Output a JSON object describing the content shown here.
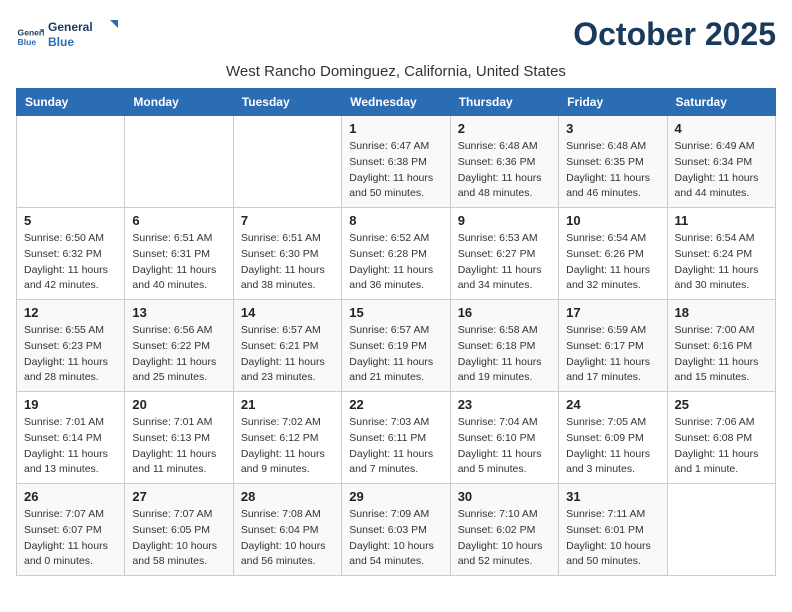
{
  "logo": {
    "general": "General",
    "blue": "Blue"
  },
  "title": "October 2025",
  "subtitle": "West Rancho Dominguez, California, United States",
  "days_of_week": [
    "Sunday",
    "Monday",
    "Tuesday",
    "Wednesday",
    "Thursday",
    "Friday",
    "Saturday"
  ],
  "weeks": [
    [
      {
        "day": "",
        "sunrise": "",
        "sunset": "",
        "daylight": ""
      },
      {
        "day": "",
        "sunrise": "",
        "sunset": "",
        "daylight": ""
      },
      {
        "day": "",
        "sunrise": "",
        "sunset": "",
        "daylight": ""
      },
      {
        "day": "1",
        "sunrise": "Sunrise: 6:47 AM",
        "sunset": "Sunset: 6:38 PM",
        "daylight": "Daylight: 11 hours and 50 minutes."
      },
      {
        "day": "2",
        "sunrise": "Sunrise: 6:48 AM",
        "sunset": "Sunset: 6:36 PM",
        "daylight": "Daylight: 11 hours and 48 minutes."
      },
      {
        "day": "3",
        "sunrise": "Sunrise: 6:48 AM",
        "sunset": "Sunset: 6:35 PM",
        "daylight": "Daylight: 11 hours and 46 minutes."
      },
      {
        "day": "4",
        "sunrise": "Sunrise: 6:49 AM",
        "sunset": "Sunset: 6:34 PM",
        "daylight": "Daylight: 11 hours and 44 minutes."
      }
    ],
    [
      {
        "day": "5",
        "sunrise": "Sunrise: 6:50 AM",
        "sunset": "Sunset: 6:32 PM",
        "daylight": "Daylight: 11 hours and 42 minutes."
      },
      {
        "day": "6",
        "sunrise": "Sunrise: 6:51 AM",
        "sunset": "Sunset: 6:31 PM",
        "daylight": "Daylight: 11 hours and 40 minutes."
      },
      {
        "day": "7",
        "sunrise": "Sunrise: 6:51 AM",
        "sunset": "Sunset: 6:30 PM",
        "daylight": "Daylight: 11 hours and 38 minutes."
      },
      {
        "day": "8",
        "sunrise": "Sunrise: 6:52 AM",
        "sunset": "Sunset: 6:28 PM",
        "daylight": "Daylight: 11 hours and 36 minutes."
      },
      {
        "day": "9",
        "sunrise": "Sunrise: 6:53 AM",
        "sunset": "Sunset: 6:27 PM",
        "daylight": "Daylight: 11 hours and 34 minutes."
      },
      {
        "day": "10",
        "sunrise": "Sunrise: 6:54 AM",
        "sunset": "Sunset: 6:26 PM",
        "daylight": "Daylight: 11 hours and 32 minutes."
      },
      {
        "day": "11",
        "sunrise": "Sunrise: 6:54 AM",
        "sunset": "Sunset: 6:24 PM",
        "daylight": "Daylight: 11 hours and 30 minutes."
      }
    ],
    [
      {
        "day": "12",
        "sunrise": "Sunrise: 6:55 AM",
        "sunset": "Sunset: 6:23 PM",
        "daylight": "Daylight: 11 hours and 28 minutes."
      },
      {
        "day": "13",
        "sunrise": "Sunrise: 6:56 AM",
        "sunset": "Sunset: 6:22 PM",
        "daylight": "Daylight: 11 hours and 25 minutes."
      },
      {
        "day": "14",
        "sunrise": "Sunrise: 6:57 AM",
        "sunset": "Sunset: 6:21 PM",
        "daylight": "Daylight: 11 hours and 23 minutes."
      },
      {
        "day": "15",
        "sunrise": "Sunrise: 6:57 AM",
        "sunset": "Sunset: 6:19 PM",
        "daylight": "Daylight: 11 hours and 21 minutes."
      },
      {
        "day": "16",
        "sunrise": "Sunrise: 6:58 AM",
        "sunset": "Sunset: 6:18 PM",
        "daylight": "Daylight: 11 hours and 19 minutes."
      },
      {
        "day": "17",
        "sunrise": "Sunrise: 6:59 AM",
        "sunset": "Sunset: 6:17 PM",
        "daylight": "Daylight: 11 hours and 17 minutes."
      },
      {
        "day": "18",
        "sunrise": "Sunrise: 7:00 AM",
        "sunset": "Sunset: 6:16 PM",
        "daylight": "Daylight: 11 hours and 15 minutes."
      }
    ],
    [
      {
        "day": "19",
        "sunrise": "Sunrise: 7:01 AM",
        "sunset": "Sunset: 6:14 PM",
        "daylight": "Daylight: 11 hours and 13 minutes."
      },
      {
        "day": "20",
        "sunrise": "Sunrise: 7:01 AM",
        "sunset": "Sunset: 6:13 PM",
        "daylight": "Daylight: 11 hours and 11 minutes."
      },
      {
        "day": "21",
        "sunrise": "Sunrise: 7:02 AM",
        "sunset": "Sunset: 6:12 PM",
        "daylight": "Daylight: 11 hours and 9 minutes."
      },
      {
        "day": "22",
        "sunrise": "Sunrise: 7:03 AM",
        "sunset": "Sunset: 6:11 PM",
        "daylight": "Daylight: 11 hours and 7 minutes."
      },
      {
        "day": "23",
        "sunrise": "Sunrise: 7:04 AM",
        "sunset": "Sunset: 6:10 PM",
        "daylight": "Daylight: 11 hours and 5 minutes."
      },
      {
        "day": "24",
        "sunrise": "Sunrise: 7:05 AM",
        "sunset": "Sunset: 6:09 PM",
        "daylight": "Daylight: 11 hours and 3 minutes."
      },
      {
        "day": "25",
        "sunrise": "Sunrise: 7:06 AM",
        "sunset": "Sunset: 6:08 PM",
        "daylight": "Daylight: 11 hours and 1 minute."
      }
    ],
    [
      {
        "day": "26",
        "sunrise": "Sunrise: 7:07 AM",
        "sunset": "Sunset: 6:07 PM",
        "daylight": "Daylight: 11 hours and 0 minutes."
      },
      {
        "day": "27",
        "sunrise": "Sunrise: 7:07 AM",
        "sunset": "Sunset: 6:05 PM",
        "daylight": "Daylight: 10 hours and 58 minutes."
      },
      {
        "day": "28",
        "sunrise": "Sunrise: 7:08 AM",
        "sunset": "Sunset: 6:04 PM",
        "daylight": "Daylight: 10 hours and 56 minutes."
      },
      {
        "day": "29",
        "sunrise": "Sunrise: 7:09 AM",
        "sunset": "Sunset: 6:03 PM",
        "daylight": "Daylight: 10 hours and 54 minutes."
      },
      {
        "day": "30",
        "sunrise": "Sunrise: 7:10 AM",
        "sunset": "Sunset: 6:02 PM",
        "daylight": "Daylight: 10 hours and 52 minutes."
      },
      {
        "day": "31",
        "sunrise": "Sunrise: 7:11 AM",
        "sunset": "Sunset: 6:01 PM",
        "daylight": "Daylight: 10 hours and 50 minutes."
      },
      {
        "day": "",
        "sunrise": "",
        "sunset": "",
        "daylight": ""
      }
    ]
  ]
}
